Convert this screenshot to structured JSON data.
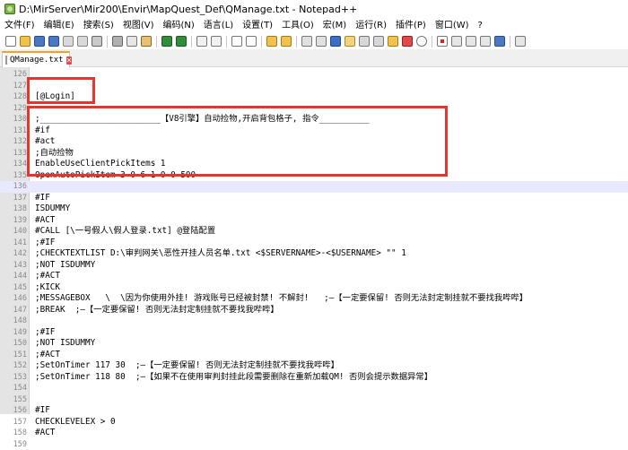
{
  "window": {
    "title": "D:\\MirServer\\Mir200\\Envir\\MapQuest_Def\\QManage.txt - Notepad++"
  },
  "menu": [
    "文件(F)",
    "编辑(E)",
    "搜索(S)",
    "视图(V)",
    "编码(N)",
    "语言(L)",
    "设置(T)",
    "工具(O)",
    "宏(M)",
    "运行(R)",
    "插件(P)",
    "窗口(W)",
    "?"
  ],
  "tab": {
    "label": "QManage.txt",
    "close_glyph": "✕"
  },
  "colors": {
    "highlight_box": "#e5352f",
    "current_line": "#e8e8ff",
    "tab_accent": "#f3a02b"
  },
  "lines": [
    {
      "n": "126",
      "t": ""
    },
    {
      "n": "127",
      "t": ""
    },
    {
      "n": "128",
      "t": "[@Login]"
    },
    {
      "n": "129",
      "t": ""
    },
    {
      "n": "130",
      "t": ";________________________【V8引擎】自动捡物,开启背包格子, 指令__________"
    },
    {
      "n": "131",
      "t": "#if"
    },
    {
      "n": "132",
      "t": "#act"
    },
    {
      "n": "133",
      "t": ";自动捡物"
    },
    {
      "n": "134",
      "t": "EnableUseClientPickItems 1"
    },
    {
      "n": "135",
      "t": "OpenAutoPickItem 3 0 6 1 0 0 500"
    },
    {
      "n": "136",
      "t": ""
    },
    {
      "n": "137",
      "t": "#IF"
    },
    {
      "n": "138",
      "t": "ISDUMMY"
    },
    {
      "n": "139",
      "t": "#ACT"
    },
    {
      "n": "140",
      "t": "#CALL [\\一号假人\\假人登录.txt] @登陆配置"
    },
    {
      "n": "141",
      "t": ";#IF"
    },
    {
      "n": "142",
      "t": ";CHECKTEXTLIST D:\\审判网关\\恶性开挂人员名单.txt <$SERVERNAME>-<$USERNAME> \"\" 1"
    },
    {
      "n": "143",
      "t": ";NOT ISDUMMY"
    },
    {
      "n": "144",
      "t": ";#ACT"
    },
    {
      "n": "145",
      "t": ";KICK"
    },
    {
      "n": "146",
      "t": ";MESSAGEBOX   \\  \\因为你使用外挂! 游戏账号已经被封禁! 不解封!   ;—【一定要保留! 否则无法封定制挂就不要找我哔哔】"
    },
    {
      "n": "147",
      "t": ";BREAK  ;—【一定要保留! 否则无法封定制挂就不要找我哔哔】"
    },
    {
      "n": "148",
      "t": ""
    },
    {
      "n": "149",
      "t": ";#IF"
    },
    {
      "n": "150",
      "t": ";NOT ISDUMMY"
    },
    {
      "n": "151",
      "t": ";#ACT"
    },
    {
      "n": "152",
      "t": ";SetOnTimer 117 30  ;—【一定要保留! 否则无法封定制挂就不要找我哔哔】"
    },
    {
      "n": "153",
      "t": ";SetOnTimer 118 80  ;—【如果不在使用审判封挂此段需要删除在重新加载QM! 否则会提示数据异常】"
    },
    {
      "n": "154",
      "t": ""
    },
    {
      "n": "155",
      "t": ""
    },
    {
      "n": "156",
      "t": "#IF"
    },
    {
      "n": "157",
      "t": "CHECKLEVELEX > 0"
    },
    {
      "n": "158",
      "t": "#ACT"
    },
    {
      "n": "159",
      "t": ""
    }
  ]
}
